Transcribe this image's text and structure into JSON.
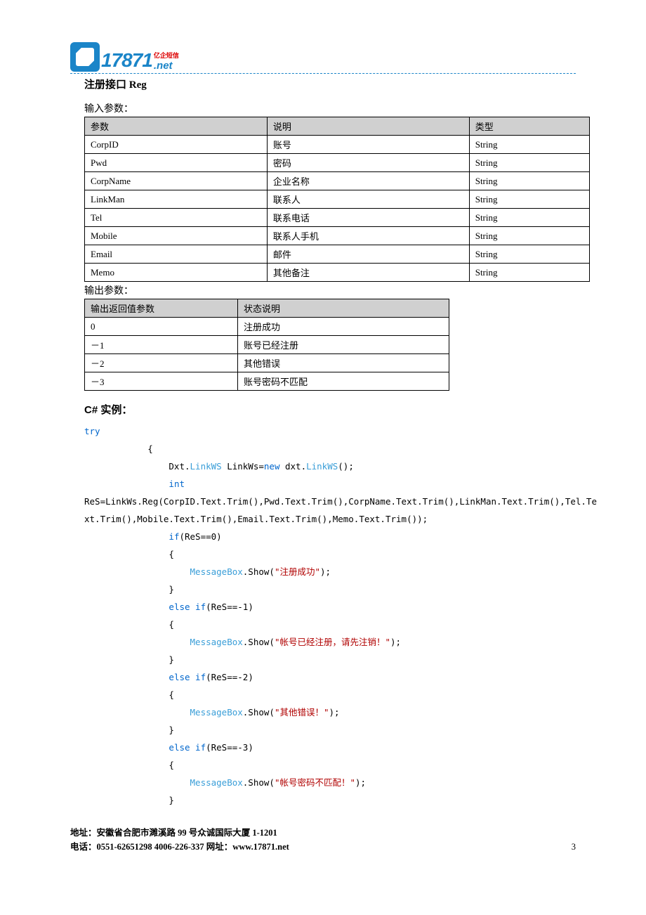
{
  "logo": {
    "num": "17871",
    "cn": "亿企短信",
    "net": ".net"
  },
  "title": "注册接口 Reg",
  "inputLabel": "输入参数：",
  "outputLabel": "输出参数：",
  "inputHeaders": {
    "c1": "参数",
    "c2": "说明",
    "c3": "类型"
  },
  "inputRows": [
    {
      "p": "CorpID",
      "d": "账号",
      "t": "String"
    },
    {
      "p": "Pwd",
      "d": "密码",
      "t": "String"
    },
    {
      "p": "CorpName",
      "d": "企业名称",
      "t": "String"
    },
    {
      "p": "LinkMan",
      "d": "联系人",
      "t": "String"
    },
    {
      "p": "Tel",
      "d": "联系电话",
      "t": "String"
    },
    {
      "p": "Mobile",
      "d": "联系人手机",
      "t": "String"
    },
    {
      "p": "Email",
      "d": "邮件",
      "t": "String"
    },
    {
      "p": "Memo",
      "d": "其他备注",
      "t": "String"
    }
  ],
  "outputHeaders": {
    "c1": "输出返回值参数",
    "c2": "状态说明"
  },
  "outputRows": [
    {
      "v": " 0",
      "d": "注册成功"
    },
    {
      "v": "－1",
      "d": "账号已经注册"
    },
    {
      "v": "－2",
      "d": "其他错误"
    },
    {
      "v": "－3",
      "d": "账号密码不匹配"
    }
  ],
  "exampleTitle": "C# 实例：",
  "code": {
    "try": "try",
    "line1a": "                Dxt.",
    "line1b": "LinkWS",
    "line1c": " LinkWs=",
    "line1d": "new",
    "line1e": " dxt.",
    "line1f": "LinkWS",
    "line1g": "();",
    "intKw": "int",
    "callA": "ReS=LinkWs.Reg(CorpID.Text.Trim(),Pwd.Text.Trim(),CorpName.Text.Trim(),LinkMan.Text.Trim(),Tel.Te",
    "callB": "xt.Trim(),Mobile.Text.Trim(),Email.Text.Trim(),Memo.Text.Trim());",
    "if0": "if",
    "cond0": "(ReS==0)",
    "mbCls": "MessageBox",
    "mbShow": ".Show(",
    "msg0": "\"注册成功\"",
    "elseKw": "else if",
    "cond1": "(ReS==-1)",
    "msg1": "\"帐号已经注册，请先注销！\"",
    "cond2": "(ReS==-2)",
    "msg2": "\"其他错误！\"",
    "cond3": "(ReS==-3)",
    "msg3": "\"帐号密码不匹配！\"",
    "close": ");"
  },
  "footer": {
    "addr": "地址：安徽省合肥市濉溪路 99 号众诚国际大厦 1-1201",
    "tel": "电话：0551-62651298  4006-226-337  网址：www.17871.net",
    "page": "3"
  }
}
